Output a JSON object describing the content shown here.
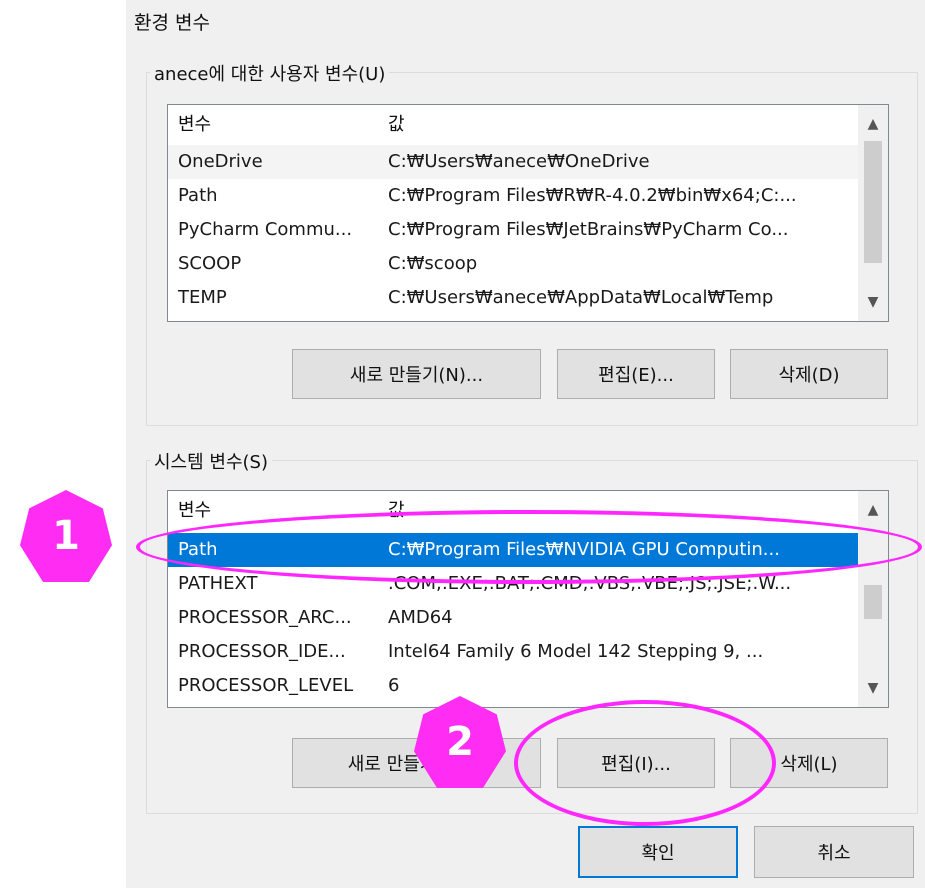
{
  "window": {
    "title": "환경 변수"
  },
  "user_vars": {
    "label": "anece에 대한 사용자 변수(U)",
    "header": {
      "name": "변수",
      "value": "값"
    },
    "rows": [
      {
        "name": "OneDrive",
        "value": "C:₩Users₩anece₩OneDrive"
      },
      {
        "name": "Path",
        "value": "C:₩Program Files₩R₩R-4.0.2₩bin₩x64;C:..."
      },
      {
        "name": "PyCharm Commu...",
        "value": "C:₩Program Files₩JetBrains₩PyCharm Co..."
      },
      {
        "name": "SCOOP",
        "value": "C:₩scoop"
      },
      {
        "name": "TEMP",
        "value": "C:₩Users₩anece₩AppData₩Local₩Temp"
      }
    ],
    "buttons": {
      "new": "새로 만들기(N)...",
      "edit": "편집(E)...",
      "delete": "삭제(D)"
    }
  },
  "system_vars": {
    "label": "시스템 변수(S)",
    "header": {
      "name": "변수",
      "value": "값"
    },
    "rows": [
      {
        "name": "Path",
        "value": "C:₩Program Files₩NVIDIA GPU Computin..."
      },
      {
        "name": "PATHEXT",
        "value": ".COM;.EXE;.BAT;.CMD;.VBS;.VBE;.JS;.JSE;.W..."
      },
      {
        "name": "PROCESSOR_ARC...",
        "value": "AMD64"
      },
      {
        "name": "PROCESSOR_IDE...",
        "value": "Intel64 Family 6 Model 142 Stepping 9, ..."
      },
      {
        "name": "PROCESSOR_LEVEL",
        "value": "6"
      }
    ],
    "buttons": {
      "new": "새로 만들기(W)...",
      "edit": "편집(I)...",
      "delete": "삭제(L)"
    }
  },
  "footer": {
    "ok": "확인",
    "cancel": "취소"
  },
  "annotations": {
    "badge1": "1",
    "badge2": "2"
  },
  "colors": {
    "selection": "#0078d7",
    "annotation": "#ff26ff"
  }
}
